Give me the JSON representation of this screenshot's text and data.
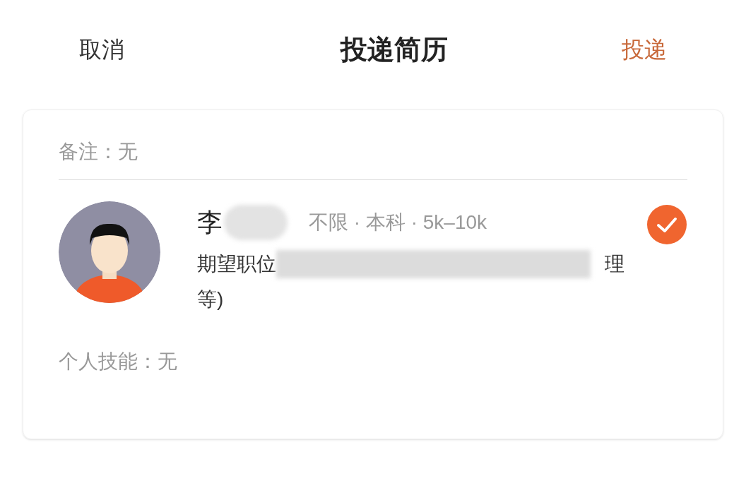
{
  "header": {
    "cancel": "取消",
    "title": "投递简历",
    "submit": "投递"
  },
  "card": {
    "note": "备注：无",
    "candidate": {
      "name": "李",
      "meta": "不限 · 本科 · 5k–10k",
      "selected": true,
      "position_label": "期望职位",
      "position_tail": "理",
      "position_end": "等)"
    },
    "skills": "个人技能：无"
  }
}
